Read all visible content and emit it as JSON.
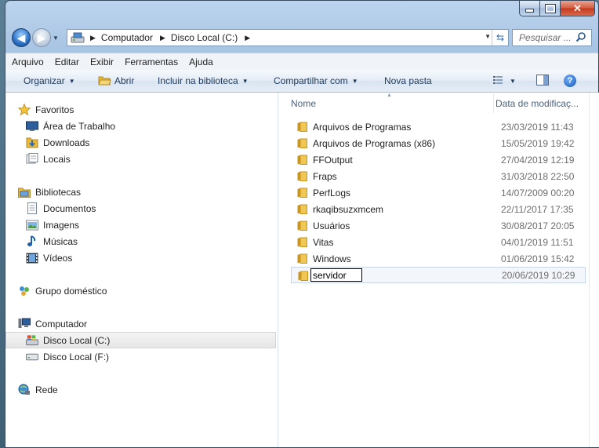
{
  "breadcrumb": [
    "Computador",
    "Disco Local (C:)"
  ],
  "search": {
    "placeholder": "Pesquisar ..."
  },
  "menu": [
    "Arquivo",
    "Editar",
    "Exibir",
    "Ferramentas",
    "Ajuda"
  ],
  "toolbar": {
    "organize": "Organizar",
    "open": "Abrir",
    "include": "Incluir na biblioteca",
    "share": "Compartilhar com",
    "new_folder": "Nova pasta"
  },
  "nav": {
    "favorites": {
      "label": "Favoritos",
      "items": [
        "Área de Trabalho",
        "Downloads",
        "Locais"
      ]
    },
    "libraries": {
      "label": "Bibliotecas",
      "items": [
        "Documentos",
        "Imagens",
        "Músicas",
        "Vídeos"
      ]
    },
    "homegroup": "Grupo doméstico",
    "computer": {
      "label": "Computador",
      "items": [
        "Disco Local (C:)",
        "Disco Local (F:)"
      ]
    },
    "network": "Rede"
  },
  "columns": {
    "name": "Nome",
    "date": "Data de modificaç..."
  },
  "files": [
    {
      "name": "Arquivos de Programas",
      "date": "23/03/2019 11:43"
    },
    {
      "name": "Arquivos de Programas (x86)",
      "date": "15/05/2019 19:42"
    },
    {
      "name": "FFOutput",
      "date": "27/04/2019 12:19"
    },
    {
      "name": "Fraps",
      "date": "31/03/2018 22:50"
    },
    {
      "name": "PerfLogs",
      "date": "14/07/2009 00:20"
    },
    {
      "name": "rkaqibsuzxmcem",
      "date": "22/11/2017 17:35"
    },
    {
      "name": "Usuários",
      "date": "30/08/2017 20:05"
    },
    {
      "name": "Vitas",
      "date": "04/01/2019 11:51"
    },
    {
      "name": "Windows",
      "date": "01/06/2019 15:42"
    }
  ],
  "rename": {
    "value": "servidor",
    "date": "20/06/2019 10:29"
  },
  "colors": {
    "folder": "#e8b93b",
    "accent": "#2e6bb5"
  }
}
